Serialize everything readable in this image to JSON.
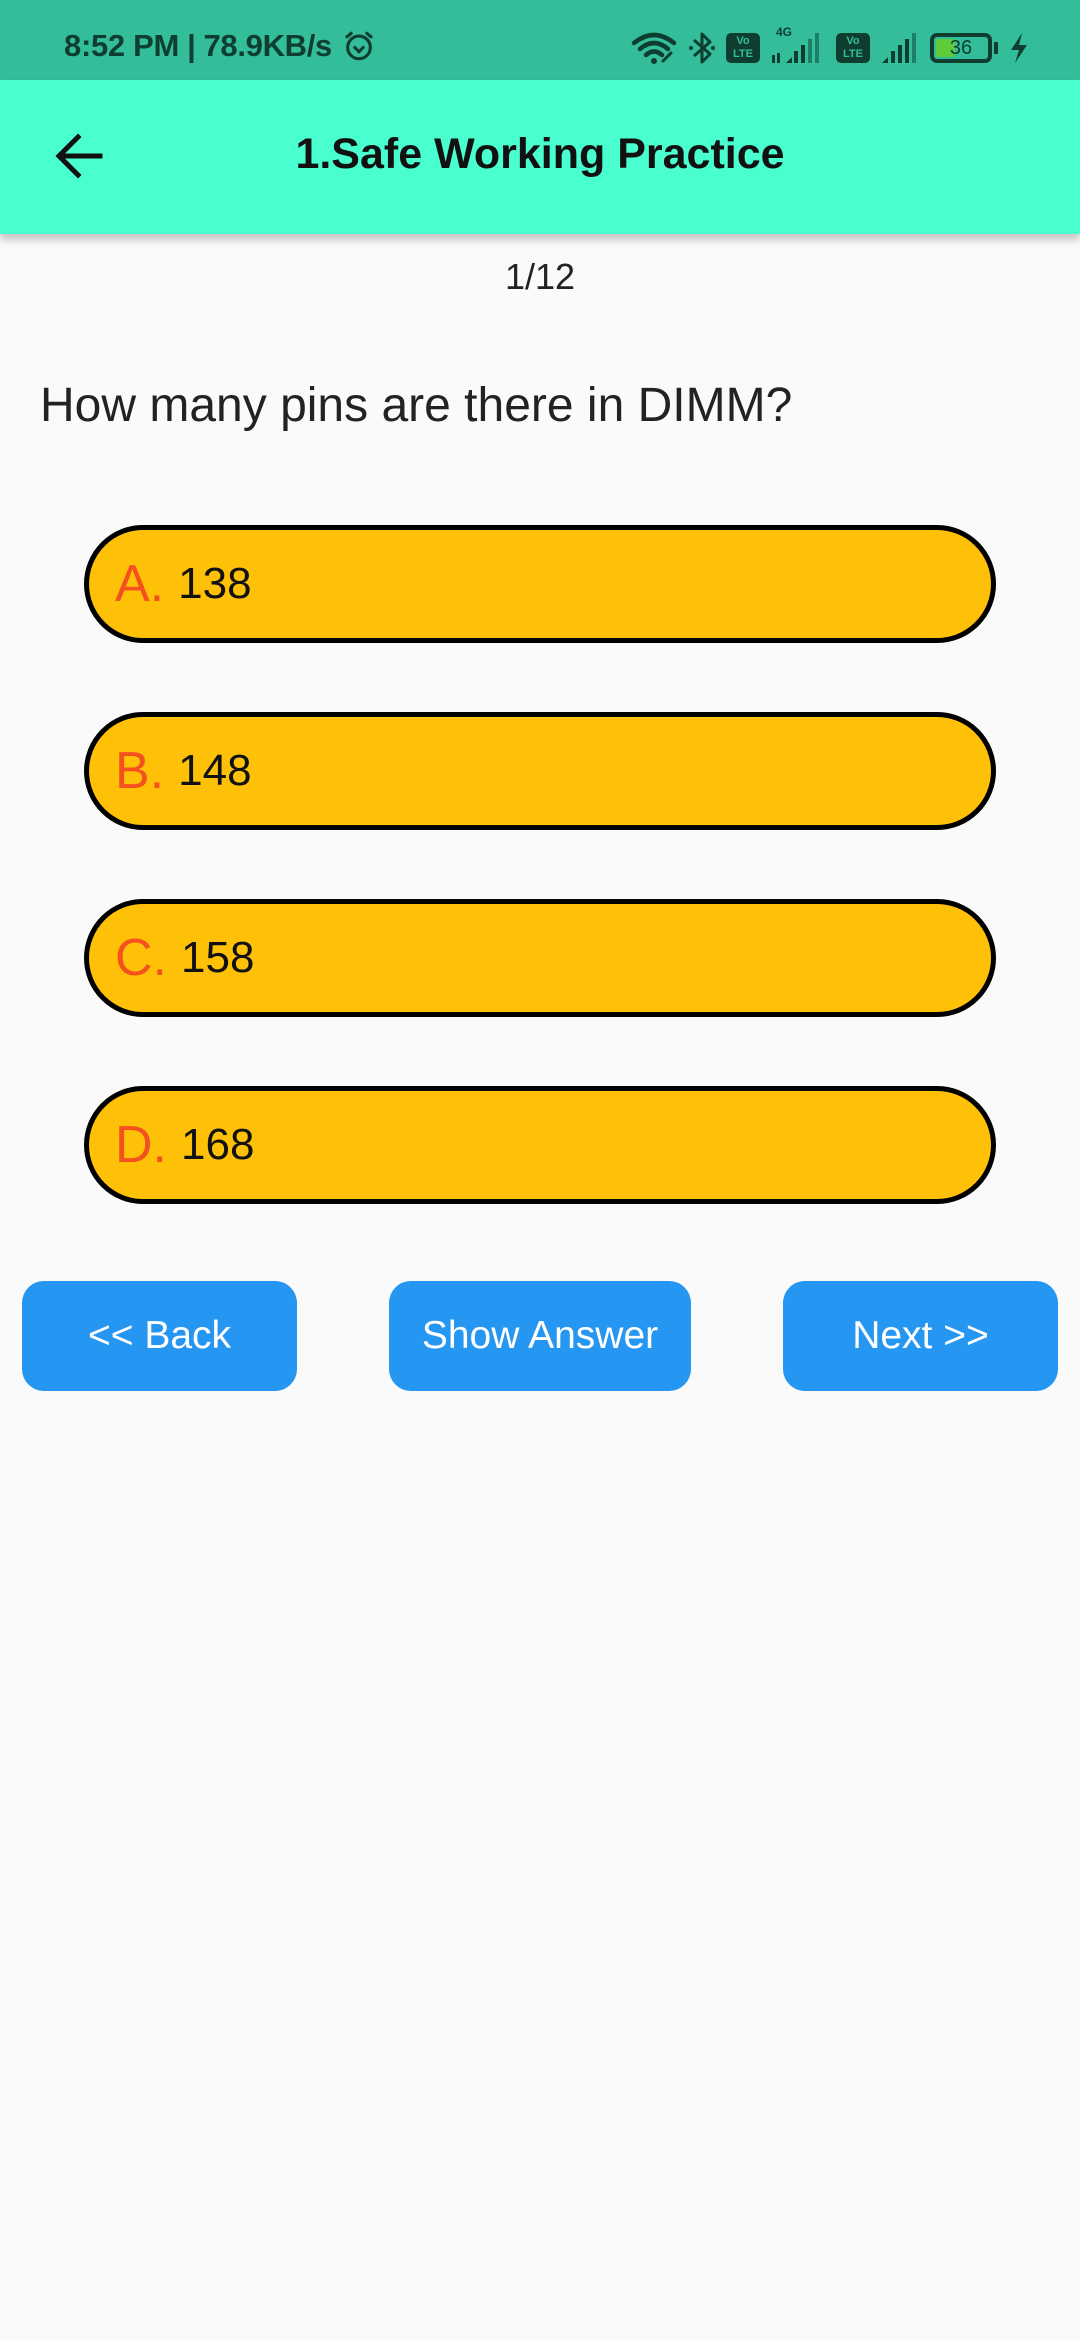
{
  "status_bar": {
    "time": "8:52 PM",
    "separator": "|",
    "network_speed": "78.9KB/s",
    "icons": [
      "alarm-icon",
      "wifi-icon",
      "bluetooth-icon",
      "volte-icon",
      "4g-signal-icon",
      "volte-icon",
      "signal-icon",
      "battery-icon",
      "charging-icon"
    ],
    "volte_label_top": "Vo",
    "volte_label_bottom": "LTE",
    "network_type": "4G",
    "battery_level": "36",
    "battery_fraction": 0.36,
    "colors": {
      "background": "#33bd9a",
      "foreground": "#0f3d30"
    }
  },
  "app_bar": {
    "back_icon": "arrow-left-icon",
    "title": "1.Safe Working Practice",
    "color": "#4affcf"
  },
  "quiz": {
    "progress": "1/12",
    "question": "How many pins are there in DIMM?",
    "options": [
      {
        "letter": "A.",
        "value": "138"
      },
      {
        "letter": "B.",
        "value": "148"
      },
      {
        "letter": "C.",
        "value": "158"
      },
      {
        "letter": "D.",
        "value": "168"
      }
    ],
    "option_colors": {
      "fill": "#fec107",
      "border": "#000000",
      "letter": "#f4511e"
    }
  },
  "buttons": {
    "back": "<< Back",
    "show_answer": "Show Answer",
    "next": "Next >>",
    "color": "#2596f1"
  }
}
